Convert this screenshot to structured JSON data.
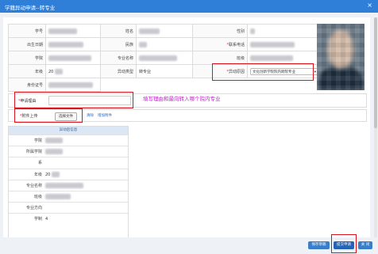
{
  "window": {
    "title": "学籍异动申请--转专业",
    "close_glyph": "×"
  },
  "student": {
    "xuehao_label": "学号",
    "xingming_label": "姓名",
    "xingbie_label": "性别",
    "birth_label": "出生日期",
    "minzu_label": "民族",
    "phone_label": "联系电话",
    "xueyuan_label": "学院",
    "major_label": "专业名称",
    "class_label": "班级",
    "grade_label": "年级",
    "grade_value": "20",
    "type_label": "异动类型",
    "type_value": "转专业",
    "reason_type_label": "异动原因",
    "reason_type_value": "文化创新学院院内跨院专业",
    "id_label": "身份证号"
  },
  "form": {
    "reason_label": "申请理由",
    "reason_annotation": "填写理由和最向转入哪个院内专业",
    "attach_label": "附件上传",
    "choose_file_label": "选择文件",
    "clear_label": "清除",
    "add_attach_label": "增加附件",
    "required_mark": "*"
  },
  "after_info": {
    "title": "异动后信息",
    "rows": [
      {
        "label": "学院",
        "value": ""
      },
      {
        "label": "所属学院",
        "value": ""
      },
      {
        "label": "系",
        "value": ""
      },
      {
        "label": "年级",
        "value": "20"
      },
      {
        "label": "专业名称",
        "value": ""
      },
      {
        "label": "班级",
        "value": ""
      },
      {
        "label": "专业方向",
        "value": ""
      },
      {
        "label": "学制",
        "value": "4"
      }
    ]
  },
  "buttons": {
    "save": "保存草稿",
    "submit": "提交申请",
    "close": "关 闭"
  },
  "colors": {
    "title_bar": "#2f7fd8",
    "annotation": "#c81ad4",
    "highlight_box": "#d9141e",
    "save_button": "#3a7dc9",
    "submit_button": "#2463b8",
    "close_button": "#3a7dc9"
  }
}
